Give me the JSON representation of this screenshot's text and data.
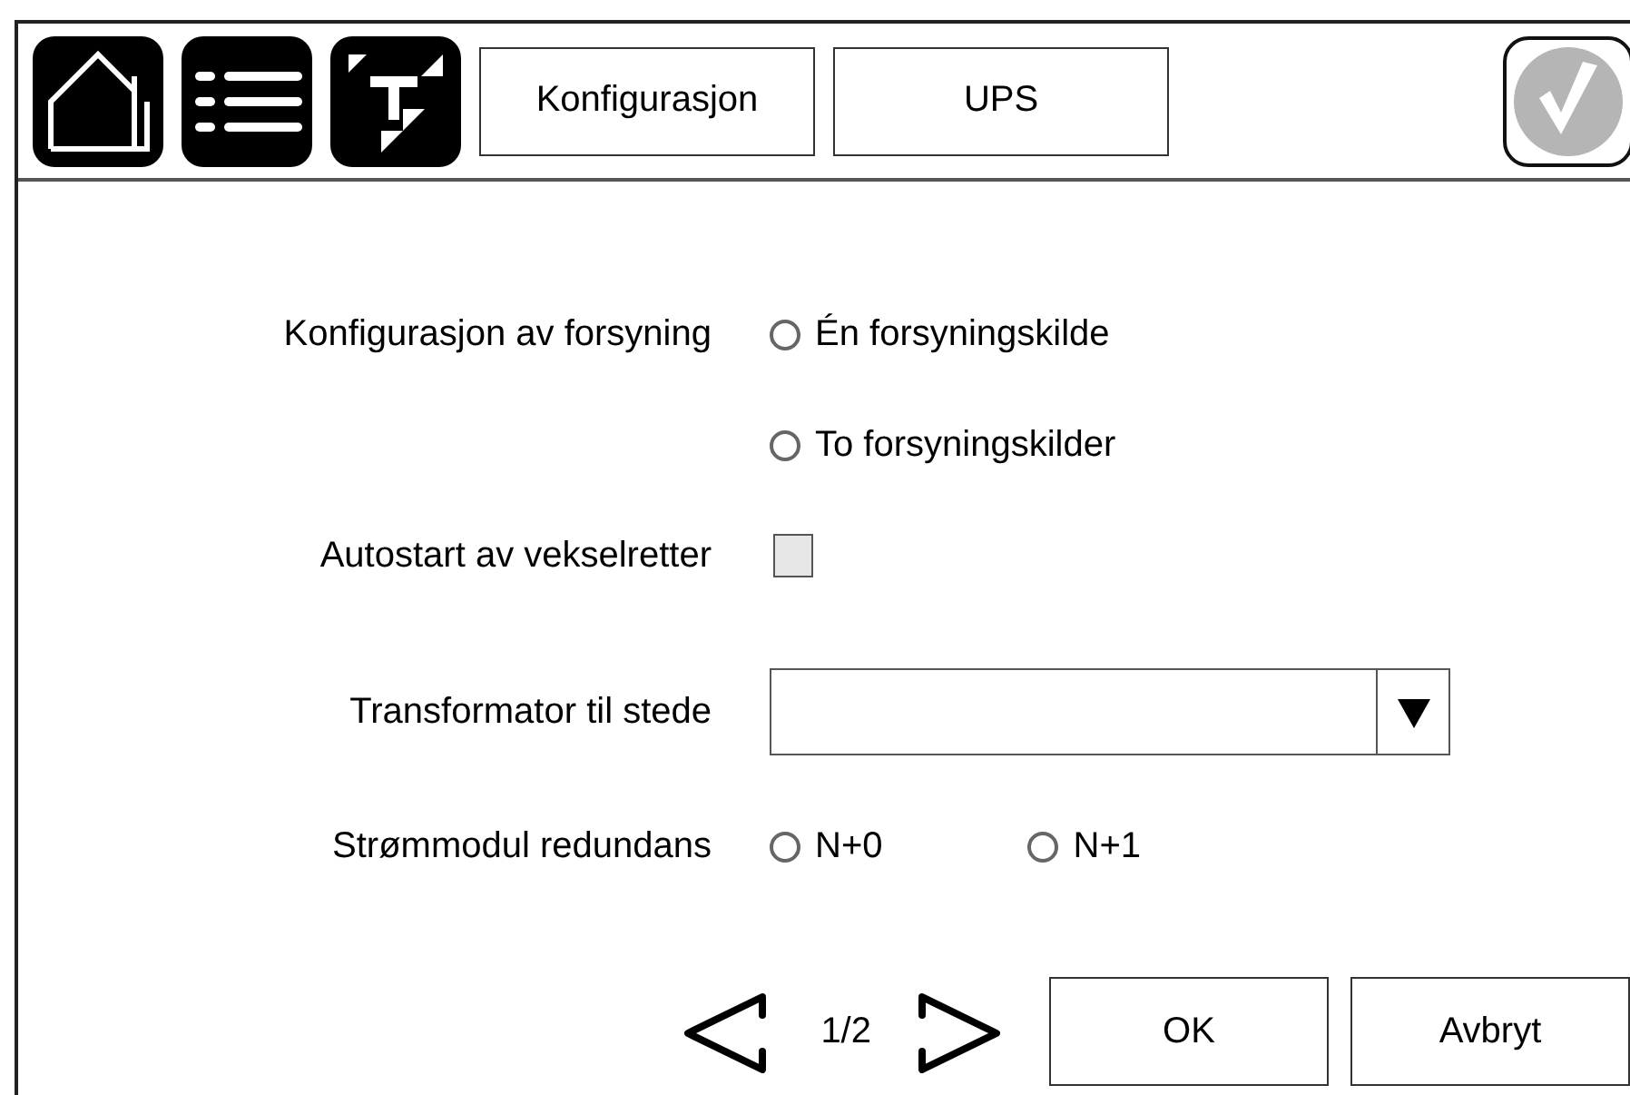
{
  "header": {
    "tabs": [
      {
        "label": "Konfigurasjon"
      },
      {
        "label": "UPS"
      }
    ],
    "confirm": {
      "disabled": true
    }
  },
  "form": [
    {
      "kind": "radio",
      "label": "Konfigurasjon av forsyning",
      "options": [
        {
          "label": "Én forsyningskilde",
          "selected": false
        }
      ]
    },
    {
      "kind": "radio",
      "options": [
        {
          "label": "To forsyningskilder",
          "selected": false
        }
      ]
    },
    {
      "kind": "checkbox",
      "label": "Autostart av vekselretter",
      "checked": false
    },
    {
      "kind": "dropdown",
      "label": "Transformator til stede"
    },
    {
      "kind": "radio",
      "label": "Strømmodul redundans",
      "options": [
        {
          "label": "N+0",
          "selected": false
        },
        {
          "label": "N+1",
          "selected": false
        }
      ]
    }
  ],
  "footer": {
    "page": "1/2",
    "buttons": [
      "OK",
      "Avbryt"
    ]
  }
}
